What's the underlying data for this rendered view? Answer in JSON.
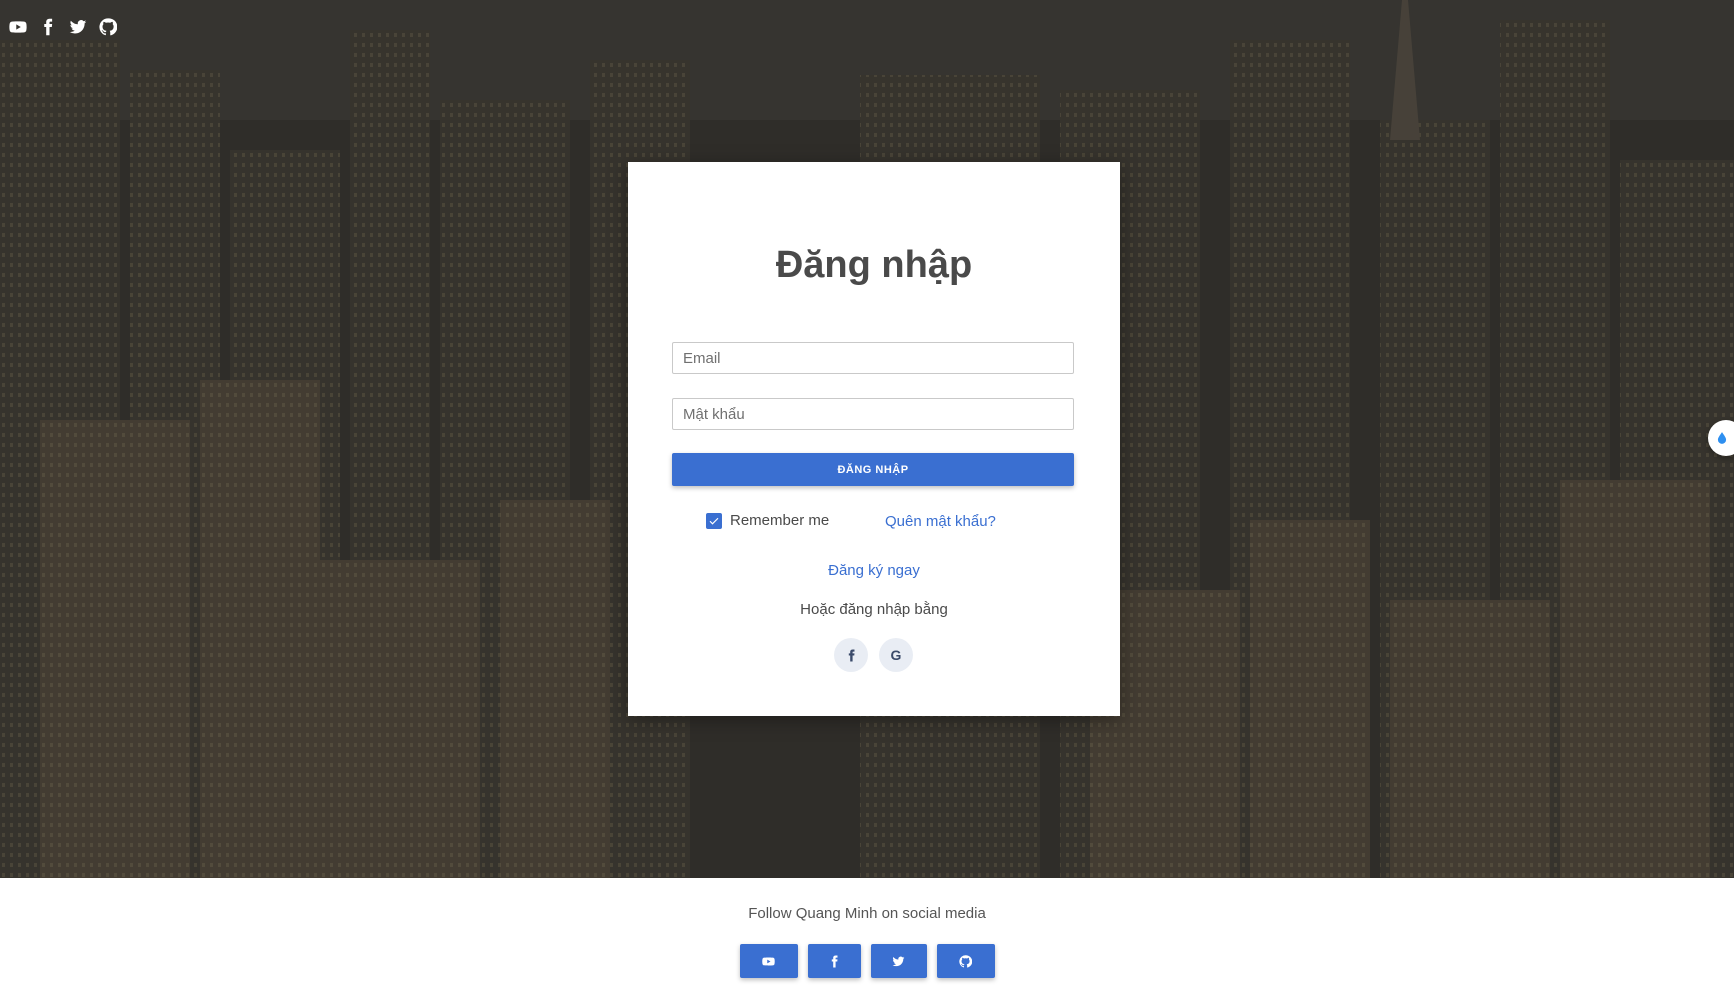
{
  "login": {
    "title": "Đăng nhập",
    "email_placeholder": "Email",
    "password_placeholder": "Mật khẩu",
    "submit_label": "ĐĂNG NHẬP",
    "remember_label": "Remember me",
    "remember_checked": true,
    "forgot_label": "Quên mật khẩu?",
    "register_label": "Đăng ký ngay",
    "or_label": "Hoặc đăng nhập bằng",
    "oauth": [
      {
        "icon": "facebook-icon"
      },
      {
        "icon": "google-icon",
        "glyph": "G"
      }
    ]
  },
  "top_social": [
    "youtube-icon",
    "facebook-icon",
    "twitter-icon",
    "github-icon"
  ],
  "footer": {
    "follow_text": "Follow Quang Minh on social media",
    "buttons": [
      "youtube-icon",
      "facebook-icon",
      "twitter-icon",
      "github-icon"
    ]
  },
  "colors": {
    "primary": "#3a6fd1",
    "title_text": "#4a4a4a",
    "footer_bg": "#ffffff"
  }
}
